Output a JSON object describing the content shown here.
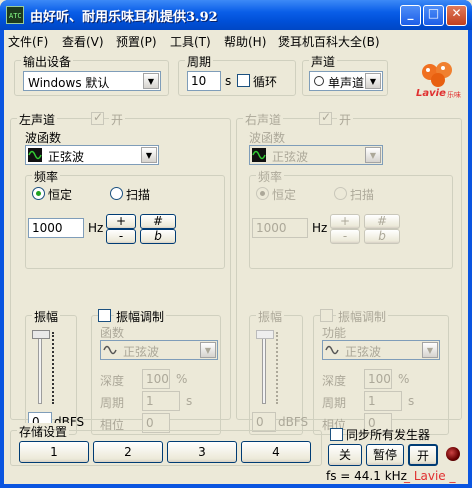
{
  "window": {
    "title": "由好听、耐用乐味耳机提供3.92",
    "icon_text": "ATC",
    "minimize": "_",
    "maximize": "□",
    "close": "✕"
  },
  "menu": [
    "文件(F)",
    "查看(V)",
    "预置(P)",
    "工具(T)",
    "帮助(H)",
    "煲耳机百科大全(B)"
  ],
  "output_device": {
    "label": "输出设备",
    "value": "Windows 默认"
  },
  "period": {
    "label": "周期",
    "value": "10",
    "unit": "s",
    "loop_label": "循环",
    "loop_checked": false
  },
  "channel": {
    "label": "声道",
    "value": "单声道"
  },
  "logo": {
    "text": "Lavie",
    "subtext": "乐味"
  },
  "left": {
    "label": "左声道",
    "enable_label": "开",
    "enabled": true,
    "waveform_label": "波函数",
    "waveform": "正弦波",
    "freq": {
      "label": "频率",
      "constant": "恒定",
      "sweep": "扫描",
      "selected": "constant",
      "value": "1000",
      "unit": "Hz",
      "plus": "+",
      "minus": "-",
      "sharp": "#",
      "flat": "b"
    },
    "amp": {
      "label": "振幅",
      "value": "0",
      "unit": "dBFS"
    },
    "mod": {
      "label": "振幅调制",
      "checked": false,
      "func_label": "函数",
      "func": "正弦波",
      "depth_label": "深度",
      "depth": "100",
      "depth_unit": "%",
      "period_label": "周期",
      "period": "1",
      "period_unit": "s",
      "phase_label": "相位",
      "phase": "0"
    }
  },
  "right": {
    "label": "右声道",
    "enable_label": "开",
    "enabled": true,
    "waveform_label": "波函数",
    "waveform": "正弦波",
    "freq": {
      "label": "频率",
      "constant": "恒定",
      "sweep": "扫描",
      "selected": "constant",
      "value": "1000",
      "unit": "Hz",
      "plus": "+",
      "minus": "-",
      "sharp": "#",
      "flat": "b"
    },
    "amp": {
      "label": "振幅",
      "value": "0",
      "unit": "dBFS"
    },
    "mod": {
      "label": "振幅调制",
      "checked": false,
      "func_label": "功能",
      "func": "正弦波",
      "depth_label": "深度",
      "depth": "100",
      "depth_unit": "%",
      "period_label": "周期",
      "period": "1",
      "period_unit": "s",
      "phase_label": "相位",
      "phase": "0"
    }
  },
  "storage": {
    "label": "存储设置",
    "buttons": [
      "1",
      "2",
      "3",
      "4"
    ]
  },
  "sync": {
    "label": "同步所有发生器",
    "checked": false
  },
  "controls": {
    "off": "关",
    "pause": "暂停",
    "on": "开"
  },
  "status": {
    "sample_rate": "fs = 44.1 kHz",
    "brand": "_ Lavie _"
  },
  "colors": {
    "title_bar": "#0a5ee8",
    "face": "#ece9d8",
    "brand_red": "#e03030",
    "check_green": "#21a121"
  }
}
